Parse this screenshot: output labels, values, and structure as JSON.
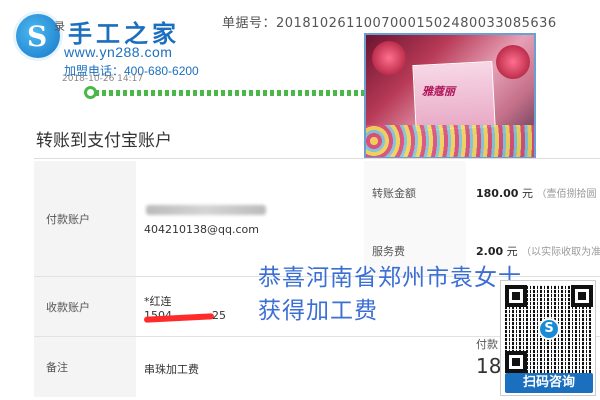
{
  "header": {
    "crumb": "录",
    "brand_title": "手工之家",
    "brand_url": "www.yn288.com",
    "brand_phone": "加盟电话：400-680-6200",
    "timestamp": "2018-10-26 14:17",
    "order_number": "单据号：20181026110070001502480033085636"
  },
  "product": {
    "box_label": "雅蔻丽"
  },
  "page": {
    "title": "转账到支付宝账户"
  },
  "form": {
    "payer_label": "付款账户",
    "payer_email": "404210138@qq.com",
    "payee_label": "收款账户",
    "payee_name": "*红连",
    "payee_phone": "1504",
    "payee_phone_tail": "25",
    "remark_label": "备注",
    "remark_value": "串珠加工费",
    "amount_label": "转账金额",
    "amount_value": "180.00",
    "amount_unit": " 元",
    "amount_hint": "（壹佰捌拾圆",
    "fee_label": "服务费",
    "fee_value": "2.00",
    "fee_unit": " 元",
    "fee_hint": "（以实际收取为准",
    "total_label": "付款",
    "total_value": "18"
  },
  "overlay": {
    "line1": "恭喜河南省郑州市袁女士",
    "line2": "获得加工费"
  },
  "qr": {
    "logo_letter": "S",
    "button_label": "扫码咨询"
  },
  "colors": {
    "brand": "#1b6fbf",
    "progress": "#49b849",
    "overlay_text": "#3b6fd4"
  }
}
